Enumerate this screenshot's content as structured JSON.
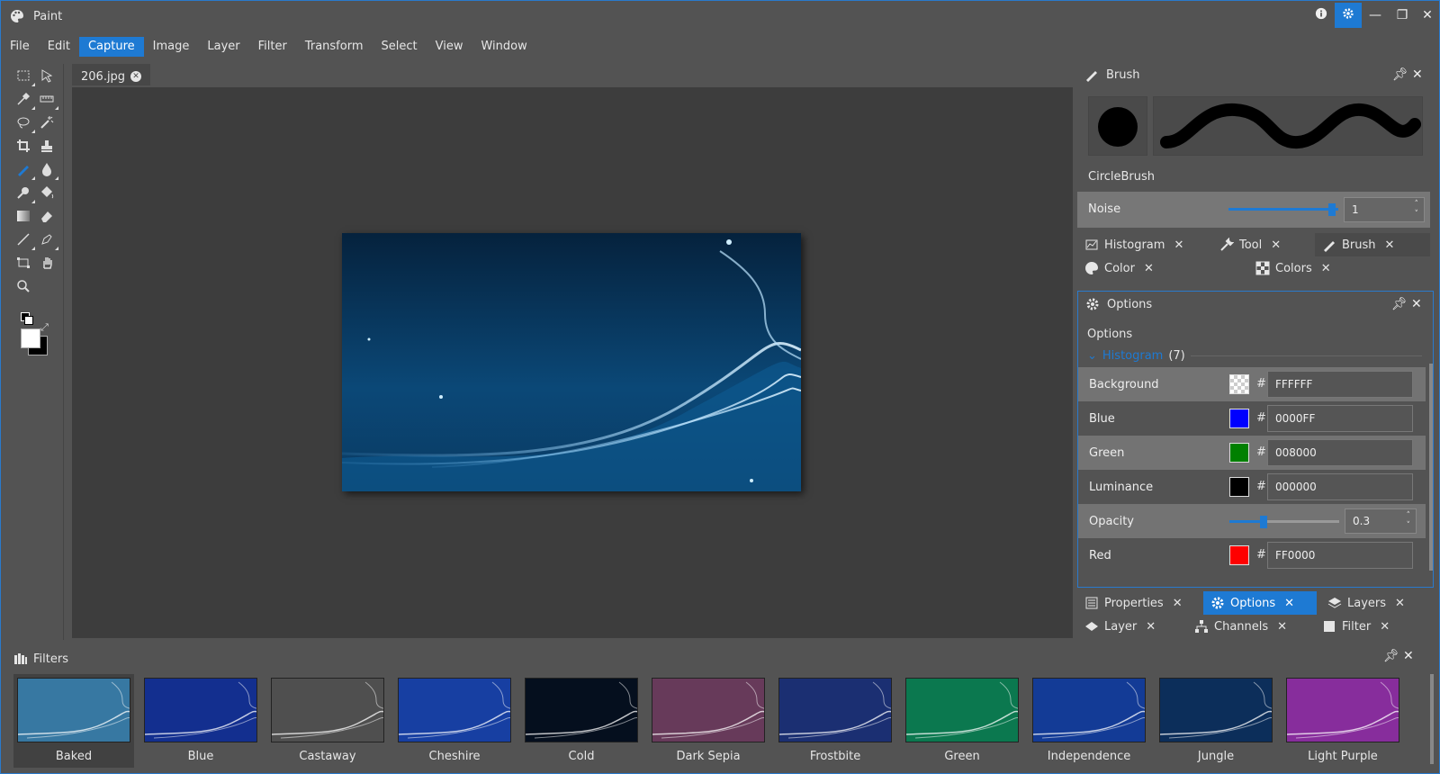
{
  "app": {
    "title": "Paint"
  },
  "titlebar_buttons": [
    "info-icon",
    "gear-icon",
    "minimize-icon",
    "restore-icon",
    "close-icon"
  ],
  "menu": [
    "File",
    "Edit",
    "Capture",
    "Image",
    "Layer",
    "Filter",
    "Transform",
    "Select",
    "View",
    "Window"
  ],
  "menu_active": "Capture",
  "document": {
    "tab": "206.jpg"
  },
  "brush_panel": {
    "title": "Brush",
    "brush_name": "CircleBrush",
    "noise_label": "Noise",
    "noise_value": "1",
    "noise_level": 0.97
  },
  "tabs_top": {
    "row1": [
      {
        "label": "Histogram",
        "icon": "histogram-icon"
      },
      {
        "label": "Tool",
        "icon": "wrench-icon"
      },
      {
        "label": "Brush",
        "icon": "brush-icon"
      }
    ],
    "row2": [
      {
        "label": "Color",
        "icon": "palette-icon"
      },
      {
        "label": "Colors",
        "icon": "grid-icon"
      }
    ]
  },
  "options_panel": {
    "title": "Options",
    "subtitle": "Options",
    "group_label": "Histogram",
    "group_count": "(7)",
    "rows": [
      {
        "label": "Background",
        "hex": "FFFFFF",
        "swatch": "transparent"
      },
      {
        "label": "Blue",
        "hex": "0000FF",
        "swatch": "#0000ff"
      },
      {
        "label": "Green",
        "hex": "008000",
        "swatch": "#008000"
      },
      {
        "label": "Luminance",
        "hex": "000000",
        "swatch": "#000000"
      },
      {
        "label": "Opacity",
        "value": "0.3",
        "level": 0.3
      },
      {
        "label": "Red",
        "hex": "FF0000",
        "swatch": "#ff0000"
      }
    ]
  },
  "tabs_bottom": {
    "row1": [
      {
        "label": "Properties",
        "icon": "properties-icon"
      },
      {
        "label": "Options",
        "icon": "gear-icon"
      },
      {
        "label": "Layers",
        "icon": "layers-icon"
      }
    ],
    "row2": [
      {
        "label": "Layer",
        "icon": "layer-icon"
      },
      {
        "label": "Channels",
        "icon": "channels-icon"
      },
      {
        "label": "Filter",
        "icon": "filter-icon"
      }
    ]
  },
  "filters": {
    "title": "Filters",
    "items": [
      "Baked",
      "Blue",
      "Castaway",
      "Cheshire",
      "Cold",
      "Dark Sepia",
      "Frostbite",
      "Green",
      "Independence",
      "Jungle",
      "Light Purple"
    ]
  },
  "colors": {
    "accent": "#1e7ad3",
    "panel": "#535353",
    "canvas": "#3d3d3d"
  }
}
